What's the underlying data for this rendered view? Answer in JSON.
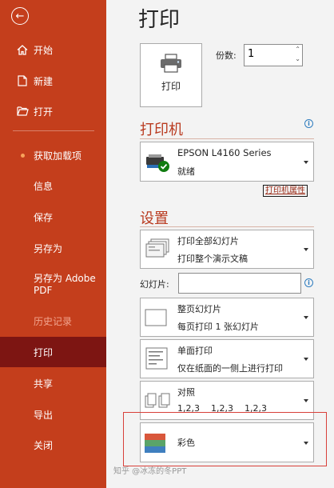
{
  "sidebar": {
    "back_label": "←",
    "items": [
      {
        "label": "开始"
      },
      {
        "label": "新建"
      },
      {
        "label": "打开"
      },
      {
        "label": "获取加载项"
      },
      {
        "label": "信息"
      },
      {
        "label": "保存"
      },
      {
        "label": "另存为"
      },
      {
        "label": "另存为 Adobe PDF"
      },
      {
        "label": "历史记录"
      },
      {
        "label": "打印"
      },
      {
        "label": "共享"
      },
      {
        "label": "导出"
      },
      {
        "label": "关闭"
      }
    ],
    "colors": {
      "background": "#c43e1c",
      "active": "#7d1512",
      "disabled_text": "#f2a58f"
    }
  },
  "main": {
    "title": "打印",
    "print_button_label": "打印",
    "copies": {
      "label": "份数:",
      "value": "1"
    },
    "printer_section": {
      "heading": "打印机",
      "printer_name": "EPSON L4160 Series",
      "printer_status": "就绪",
      "properties_link": "打印机属性"
    },
    "settings_section": {
      "heading": "设置",
      "slide_range": {
        "title": "打印全部幻灯片",
        "subtitle": "打印整个演示文稿"
      },
      "slides_label": "幻灯片:",
      "slides_value": "",
      "layout": {
        "title": "整页幻灯片",
        "subtitle": "每页打印 1 张幻灯片"
      },
      "sides": {
        "title": "单面打印",
        "subtitle": "仅在纸面的一侧上进行打印"
      },
      "collate": {
        "title": "对照",
        "subtitle": "1,2,3    1,2,3    1,2,3"
      },
      "color": {
        "title": "彩色"
      }
    }
  },
  "watermark": "知乎 @冰冻的冬PPT"
}
